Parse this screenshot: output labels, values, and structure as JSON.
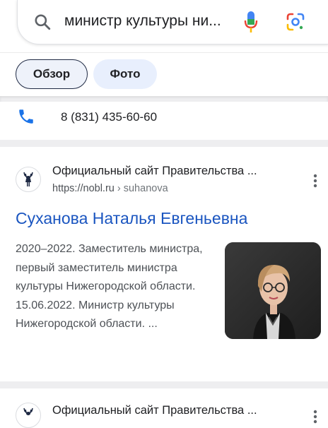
{
  "search": {
    "query": "министр культуры ни..."
  },
  "tabs": [
    {
      "label": "Обзор"
    },
    {
      "label": "Фото"
    }
  ],
  "contact": {
    "phone": "8 (831) 435-60-60"
  },
  "results": [
    {
      "site_name": "Официальный сайт Правительства ...",
      "url": "https://nobl.ru",
      "url_path": " › suhanova",
      "title": "Суханова Наталья Евгеньевна",
      "snippet": "2020–2022. Заместитель министра, первый заместитель министра культуры Нижегородской области. 15.06.2022. Министр культуры Нижегородской области. ..."
    },
    {
      "site_name": "Официальный сайт Правительства ..."
    }
  ],
  "colors": {
    "link": "#1a55c0",
    "phone_icon": "#1a73e8"
  },
  "icons": [
    "search-icon",
    "mic-icon",
    "lens-icon",
    "phone-icon",
    "more-options-icon",
    "deer-favicon-icon"
  ]
}
